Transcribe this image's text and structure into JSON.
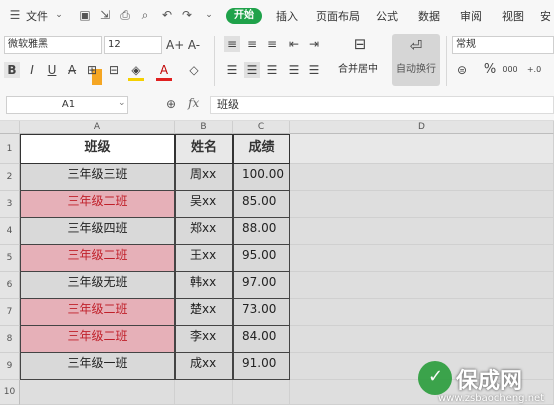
{
  "menubar": {
    "file_label": "文件",
    "tabs": [
      "开始",
      "插入",
      "页面布局",
      "公式",
      "数据",
      "审阅",
      "视图",
      "安"
    ]
  },
  "ribbon": {
    "font_name": "微软雅黑",
    "font_size": "12",
    "merge_label": "合并居中",
    "wrap_label": "自动换行",
    "number_format": "常规",
    "bold": "B",
    "italic": "I",
    "underline": "U",
    "font_color_glyph": "A",
    "grow_font": "A+",
    "shrink_font": "A-",
    "percent": "%",
    "inc_decimal": "000",
    "dec_decimal": "+.0"
  },
  "formula_bar": {
    "cell_ref": "A1",
    "fx": "fx",
    "value": "班级"
  },
  "sheet": {
    "columns": [
      "A",
      "B",
      "C",
      "D"
    ],
    "rows": [
      "1",
      "2",
      "3",
      "4",
      "5",
      "6",
      "7",
      "8",
      "9",
      "10"
    ],
    "header": [
      "班级",
      "姓名",
      "成绩"
    ],
    "data": [
      {
        "class": "三年级三班",
        "name": "周xx",
        "score": "100.00",
        "highlight": false
      },
      {
        "class": "三年级二班",
        "name": "吴xx",
        "score": "85.00",
        "highlight": true
      },
      {
        "class": "三年级四班",
        "name": "郑xx",
        "score": "88.00",
        "highlight": false
      },
      {
        "class": "三年级二班",
        "name": "王xx",
        "score": "95.00",
        "highlight": true
      },
      {
        "class": "三年级无班",
        "name": "韩xx",
        "score": "97.00",
        "highlight": false
      },
      {
        "class": "三年级二班",
        "name": "楚xx",
        "score": "73.00",
        "highlight": true
      },
      {
        "class": "三年级二班",
        "name": "李xx",
        "score": "84.00",
        "highlight": true
      },
      {
        "class": "三年级一班",
        "name": "成xx",
        "score": "91.00",
        "highlight": false
      }
    ]
  },
  "colors": {
    "accent": "#1fa24a",
    "highlight_fill": "#e6b0b8",
    "highlight_text": "#c0202a",
    "normal_fill": "#d9d9d9"
  },
  "watermark": {
    "brand": "保成网",
    "url": "www.zsbaocheng.net"
  }
}
